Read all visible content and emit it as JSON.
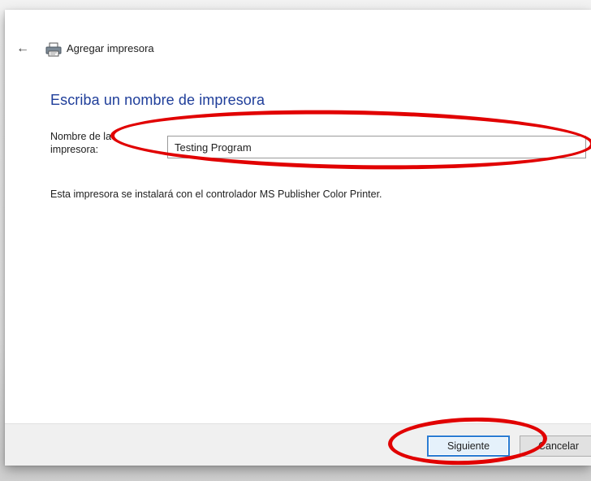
{
  "window": {
    "title": "Agregar impresora"
  },
  "page": {
    "heading": "Escriba un nombre de impresora",
    "printer_name_label": "Nombre de la impresora:",
    "printer_name_value": "Testing Program",
    "info_text": "Esta impresora se instalará con el controlador MS Publisher Color Printer."
  },
  "footer": {
    "next_label": "Siguiente",
    "cancel_label": "Cancelar"
  },
  "icons": {
    "back": "arrow-left-icon",
    "printer": "printer-icon"
  },
  "colors": {
    "heading": "#1f3e9a",
    "annotation": "#e10000",
    "focus_border": "#2b7cd3"
  }
}
